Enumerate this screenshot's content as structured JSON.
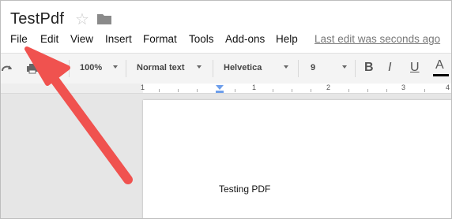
{
  "document": {
    "title": "TestPdf"
  },
  "menu": {
    "items": [
      "File",
      "Edit",
      "View",
      "Insert",
      "Format",
      "Tools",
      "Add-ons",
      "Help"
    ],
    "last_edit": "Last edit was seconds ago"
  },
  "toolbar": {
    "zoom": "100%",
    "style": "Normal text",
    "font": "Helvetica",
    "size": "9",
    "bold_label": "B",
    "italic_label": "I",
    "underline_label": "U",
    "text_color_label": "A"
  },
  "ruler": {
    "labels": [
      "1",
      "1",
      "2",
      "3",
      "4"
    ]
  },
  "page": {
    "body_text": "Testing PDF"
  },
  "colors": {
    "arrow": "#f0524f",
    "indent_marker": "#6d9eeb"
  },
  "icons": [
    "star-icon",
    "folder-icon",
    "redo-icon",
    "print-icon",
    "paint-format-icon",
    "arrow-annotation"
  ]
}
